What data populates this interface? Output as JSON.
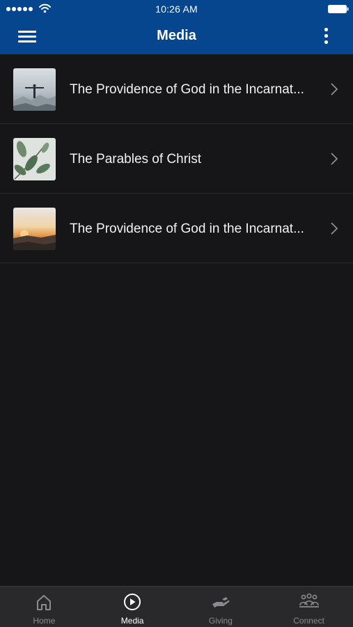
{
  "status_bar": {
    "time": "10:26 AM"
  },
  "nav": {
    "title": "Media"
  },
  "media_items": [
    {
      "title": "The Providence of God in the Incarnat...",
      "thumbnail": "person-on-mountain-image"
    },
    {
      "title": "The Parables of Christ",
      "thumbnail": "leaves-image"
    },
    {
      "title": "The Providence of God in the Incarnat...",
      "thumbnail": "sunset-image"
    }
  ],
  "tabs": [
    {
      "label": "Home",
      "icon": "home-icon",
      "active": false
    },
    {
      "label": "Media",
      "icon": "play-circle-icon",
      "active": true
    },
    {
      "label": "Giving",
      "icon": "giving-hand-icon",
      "active": false
    },
    {
      "label": "Connect",
      "icon": "people-icon",
      "active": false
    }
  ],
  "colors": {
    "nav_background": "#06468f",
    "content_background": "#161618",
    "tab_bar_background": "#29292c",
    "tab_active": "#ffffff",
    "tab_inactive": "#8a8a8f"
  }
}
